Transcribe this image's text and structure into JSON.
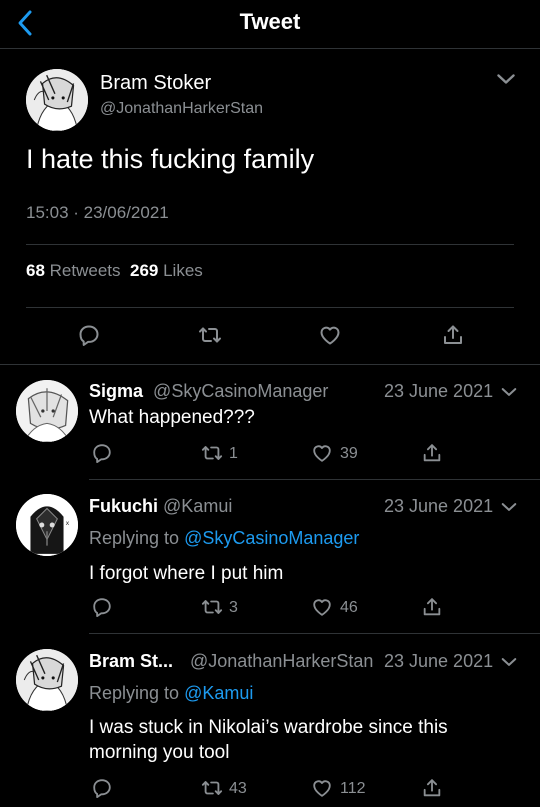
{
  "header": {
    "title": "Tweet",
    "back_icon": "back-chevron-icon"
  },
  "tweet": {
    "name": "Bram Stoker",
    "handle": "@JonathanHarkerStan",
    "text": "I hate this fucking family",
    "timestamp": "15:03 · 23/06/2021",
    "retweets_count": "68",
    "retweets_label": "Retweets",
    "likes_count": "269",
    "likes_label": "Likes"
  },
  "replies": [
    {
      "name": "Sigma",
      "handle": "@SkyCasinoManager",
      "date": "23 June 2021",
      "text": "What happened???",
      "replying_to": "",
      "retweets": "1",
      "likes": "39"
    },
    {
      "name": "Fukuchi",
      "handle": "@Kamui",
      "date": "23 June 2021",
      "replying_label": "Replying to",
      "replying_to": "@SkyCasinoManager",
      "text": "I forgot where I put him",
      "retweets": "3",
      "likes": "46"
    },
    {
      "name": "Bram St...",
      "handle": "@JonathanHarkerStan",
      "date": "23 June 2021",
      "replying_label": "Replying to",
      "replying_to": "@Kamui",
      "text_line1": "I was stuck in Nikolai’s wardrobe since this",
      "text_line2": "morning you tool",
      "retweets": "43",
      "likes": "112"
    }
  ],
  "colors": {
    "background": "#000000",
    "accent": "#1d9bf0",
    "secondary_text": "#8b8f93"
  }
}
